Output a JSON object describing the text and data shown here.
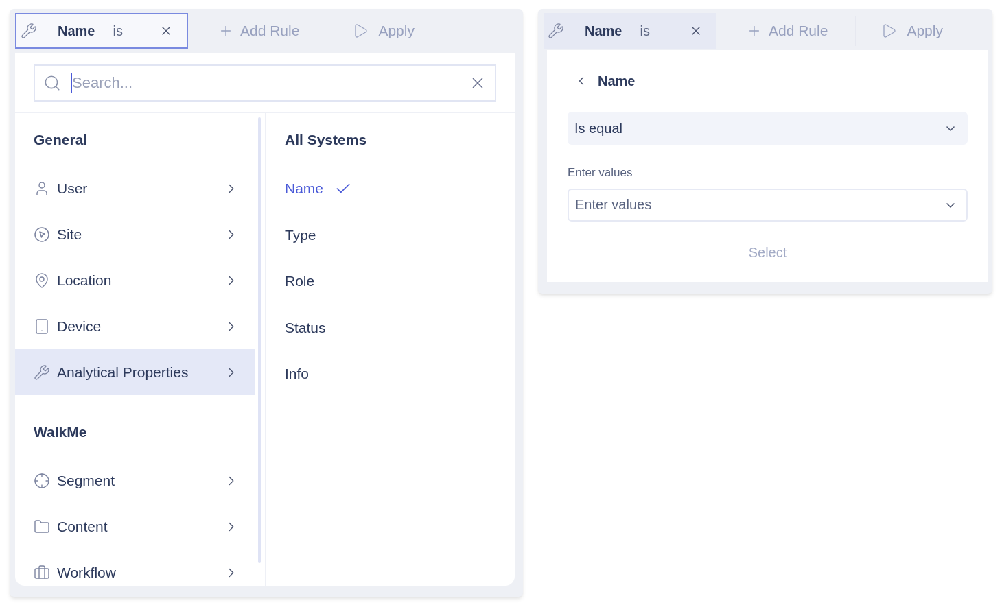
{
  "left_panel": {
    "filter_chip": {
      "field": "Name",
      "operator": "is",
      "selected": true
    },
    "add_rule": "Add Rule",
    "apply": "Apply",
    "search": {
      "placeholder": "Search..."
    },
    "groups": [
      {
        "title": "General",
        "items": [
          {
            "label": "User",
            "selected": false
          },
          {
            "label": "Site",
            "selected": false
          },
          {
            "label": "Location",
            "selected": false
          },
          {
            "label": "Device",
            "selected": false
          },
          {
            "label": "Analytical Properties",
            "selected": true
          }
        ]
      },
      {
        "title": "WalkMe",
        "items": [
          {
            "label": "Segment",
            "selected": false
          },
          {
            "label": "Content",
            "selected": false
          },
          {
            "label": "Workflow",
            "selected": false
          }
        ]
      }
    ],
    "options_title": "All Systems",
    "options": [
      {
        "label": "Name",
        "selected": true
      },
      {
        "label": "Type",
        "selected": false
      },
      {
        "label": "Role",
        "selected": false
      },
      {
        "label": "Status",
        "selected": false
      },
      {
        "label": "Info",
        "selected": false
      }
    ]
  },
  "right_panel": {
    "filter_chip": {
      "field": "Name",
      "operator": "is",
      "selected": false
    },
    "add_rule": "Add Rule",
    "apply": "Apply",
    "back_title": "Name",
    "condition": {
      "value": "Is equal"
    },
    "values_label": "Enter values",
    "values_field": {
      "placeholder": "Enter values"
    },
    "select_button": {
      "label": "Select",
      "disabled": true
    }
  }
}
